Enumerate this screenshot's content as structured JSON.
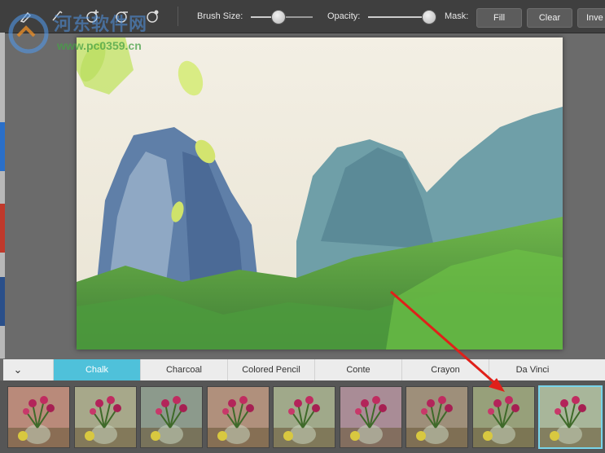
{
  "toolbar": {
    "tools": [
      {
        "name": "brush-tool-icon"
      },
      {
        "name": "pen-tool-icon"
      },
      {
        "name": "brush-add-icon"
      },
      {
        "name": "brush-remove-icon"
      }
    ],
    "brush_size_label": "Brush Size:",
    "brush_size_value": 0.43,
    "opacity_label": "Opacity:",
    "opacity_value": 0.95,
    "mask_label": "Mask:",
    "fill_label": "Fill",
    "clear_label": "Clear",
    "invert_label": "Inve"
  },
  "watermark": {
    "text": "河东软件网",
    "url": "www.pc0359.cn"
  },
  "styles": {
    "tabs": [
      "Chalk",
      "Charcoal",
      "Colored Pencil",
      "Conte",
      "Crayon",
      "Da Vinci"
    ],
    "active_tab": "Chalk"
  },
  "thumbnails": {
    "count": 9,
    "selected_index": 8
  },
  "colors": {
    "accent": "#4fc1da",
    "arrow": "#e0201a"
  }
}
